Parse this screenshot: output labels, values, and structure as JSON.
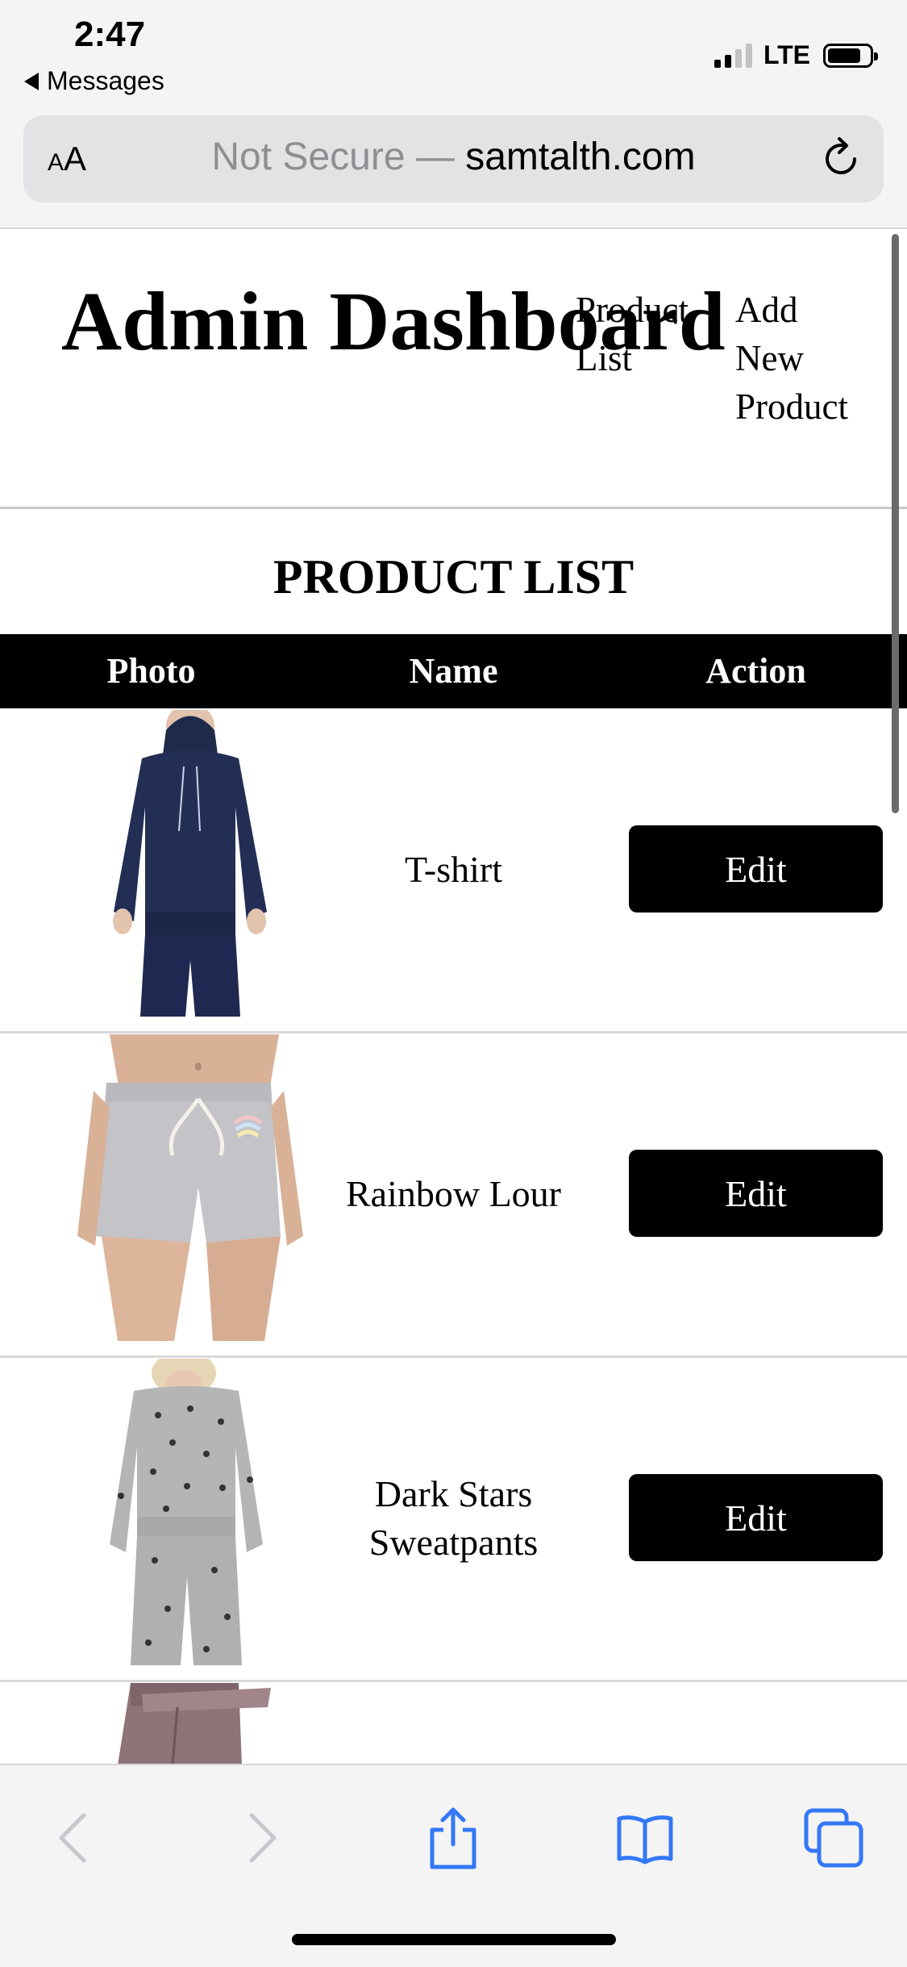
{
  "status_bar": {
    "time": "2:47",
    "back_app": "Messages",
    "network": "LTE"
  },
  "safari": {
    "text_size_small": "A",
    "text_size_big": "A",
    "security_label": "Not Secure —",
    "domain": "samtalth.com"
  },
  "site": {
    "title": "Admin Dashboard",
    "nav": {
      "product_list": "Product List",
      "add_new_product": "Add New Product"
    }
  },
  "product_list": {
    "heading": "PRODUCT LIST",
    "columns": {
      "photo": "Photo",
      "name": "Name",
      "action": "Action"
    },
    "rows": [
      {
        "name": "T-shirt",
        "action": "Edit"
      },
      {
        "name": "Rainbow Lour",
        "action": "Edit"
      },
      {
        "name": "Dark Stars Sweatpants",
        "action": "Edit"
      }
    ]
  },
  "colors": {
    "header_bg": "#000000",
    "button_bg": "#000000",
    "toolbar_blue": "#3478f6",
    "toolbar_disabled": "#c7c7cc"
  }
}
